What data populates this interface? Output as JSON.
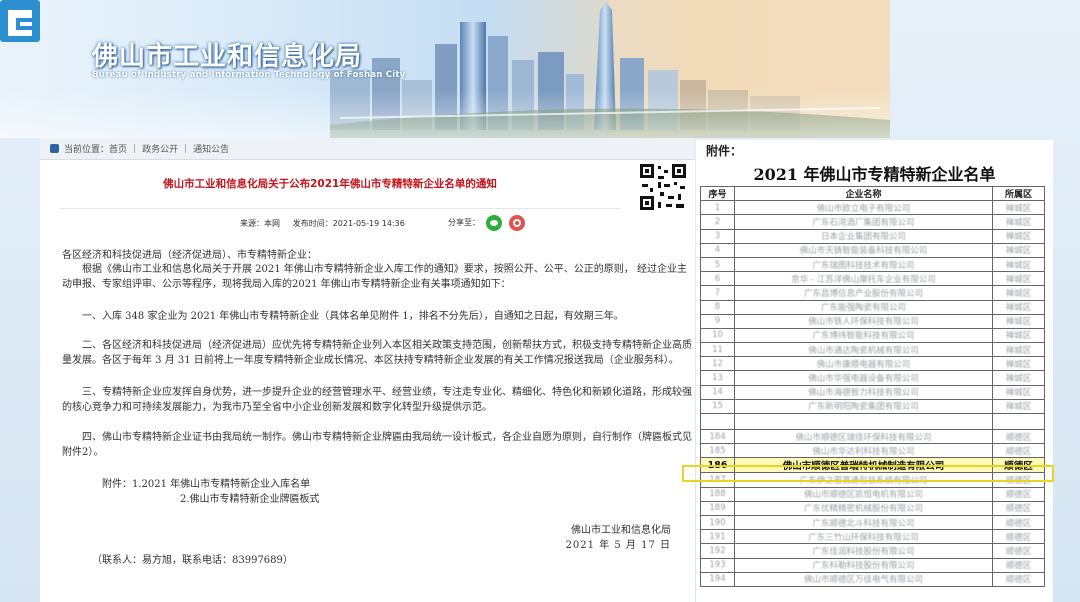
{
  "header": {
    "site_title": "佛山市工业和信息化局",
    "site_subtitle": "Bureau of Industry and Information Technology of Foshan City"
  },
  "breadcrumb": {
    "prefix": "当前位置：",
    "items": [
      "首页",
      "政务公开",
      "通知公告"
    ],
    "separator": "|"
  },
  "article": {
    "title": "佛山市工业和信息化局关于公布2021年佛山市专精特新企业名单的通知",
    "source": "来源：本网",
    "published": "发布时间：2021-05-19 14:36",
    "share_label": "分享至：",
    "greeting": "各区经济和科技促进局（经济促进局）、市专精特新企业：",
    "intro": "根据《佛山市工业和信息化局关于开展 2021 年佛山市专精特新企业入库工作的通知》要求，按照公开、公平、公正的原则， 经过企业主动申报、专家组评审、公示等程序，现将我局入库的2021 年佛山市专精特新企业有关事项通知如下：",
    "item1": "一、入库 348 家企业为 2021 年佛山市专精特新企业（具体名单见附件 1，排名不分先后），自通知之日起，有效期三年。",
    "item2": "二、各区经济和科技促进局（经济促进局）应优先将专精特新企业列入本区相关政策支持范围，创新帮扶方式，积极支持专精特新企业高质量发展。各区于每年 3 月 31 日前将上一年度专精特新企业成长情况、本区扶持专精特新企业发展的有关工作情况报送我局（企业服务科）。",
    "item3": "三、专精特新企业应发挥自身优势，进一步提升企业的经营管理水平、经营业绩，专注走专业化、精细化、特色化和新颖化道路，形成较强的核心竞争力和可持续发展能力，为我市乃至全省中小企业创新发展和数字化转型升级提供示范。",
    "item4": "四、佛山市专精特新企业证书由我局统一制作。佛山市专精特新企业牌匾由我局统一设计板式，各企业自愿为原则，自行制作（牌匾板式见附件2）。",
    "attachments_label": "附件：1.2021 年佛山市专精特新企业入库名单",
    "attachment_2": "2.佛山市专精特新企业牌匾板式",
    "signature_org": "佛山市工业和信息化局",
    "signature_date": "2021 年 5 月 17 日",
    "contact": "（联系人：易方旭，联系电话：83997689）"
  },
  "list": {
    "label": "附件：",
    "title": "2021 年佛山市专精特新企业名单",
    "headers": [
      "序号",
      "企业名称",
      "所属区"
    ],
    "rows_top": [
      {
        "no": "1",
        "name": "佛山市欧立电子有限公司",
        "district": "禅城区"
      },
      {
        "no": "2",
        "name": "广东石湾酒厂集团有限公司",
        "district": "禅城区"
      },
      {
        "no": "3",
        "name": "日本企业集团有限公司",
        "district": "禅城区"
      },
      {
        "no": "4",
        "name": "佛山市天铸智能装备科技有限公司",
        "district": "禅城区"
      },
      {
        "no": "5",
        "name": "广东瑞图科技技术有限公司",
        "district": "禅城区"
      },
      {
        "no": "6",
        "name": "京华 - 江苏洋佛山摩托车企业有限公司",
        "district": "禅城区"
      },
      {
        "no": "7",
        "name": "广东昌博信息产业股份有限公司",
        "district": "禅城区"
      },
      {
        "no": "8",
        "name": "广东能强陶瓷有限公司",
        "district": "禅城区"
      },
      {
        "no": "9",
        "name": "佛山市铁人环保科技有限公司",
        "district": "禅城区"
      },
      {
        "no": "10",
        "name": "广东博纬智能科技有限公司",
        "district": "禅城区"
      },
      {
        "no": "11",
        "name": "佛山市通达陶瓷机械有限公司",
        "district": "禅城区"
      },
      {
        "no": "12",
        "name": "佛山市康顺电器有限公司",
        "district": "禅城区"
      },
      {
        "no": "13",
        "name": "佛山市华强电器设备有限公司",
        "district": "禅城区"
      },
      {
        "no": "14",
        "name": "佛山市海德智力科技有限公司",
        "district": "禅城区"
      },
      {
        "no": "15",
        "name": "广东新明阳陶瓷集团有限公司",
        "district": "禅城区"
      }
    ],
    "rows_bottom": [
      {
        "no": "184",
        "name": "佛山市顺德区瑞佳环保科技有限公司",
        "district": "顺德区"
      },
      {
        "no": "185",
        "name": "佛山市华达利科技有限公司",
        "district": "顺德区"
      },
      {
        "no": "186",
        "name": "佛山市顺德区普瑞特机械制造有限公司",
        "district": "顺德区",
        "highlight": true
      },
      {
        "no": "187",
        "name": "广东伊之密高速包装系统有限公司",
        "district": "顺德区"
      },
      {
        "no": "188",
        "name": "佛山市顺德区凯恒电机有限公司",
        "district": "顺德区"
      },
      {
        "no": "189",
        "name": "广东优精精密机械股份有限公司",
        "district": "顺德区"
      },
      {
        "no": "190",
        "name": "广东顺德北斗科技有限公司",
        "district": "顺德区"
      },
      {
        "no": "191",
        "name": "广东三竹山环保科技有限公司",
        "district": "顺德区"
      },
      {
        "no": "192",
        "name": "广东佳润科技股份有限公司",
        "district": "顺德区"
      },
      {
        "no": "193",
        "name": "广东科勒科技股份有限公司",
        "district": "顺德区"
      },
      {
        "no": "194",
        "name": "佛山市顺德区万佳电气有限公司",
        "district": "顺德区"
      }
    ]
  },
  "colors": {
    "title_red": "#c4141b",
    "highlight_yellow": "#fdf9b8",
    "highlight_border": "#e8d51f",
    "brand_blue": "#2b65a8"
  }
}
